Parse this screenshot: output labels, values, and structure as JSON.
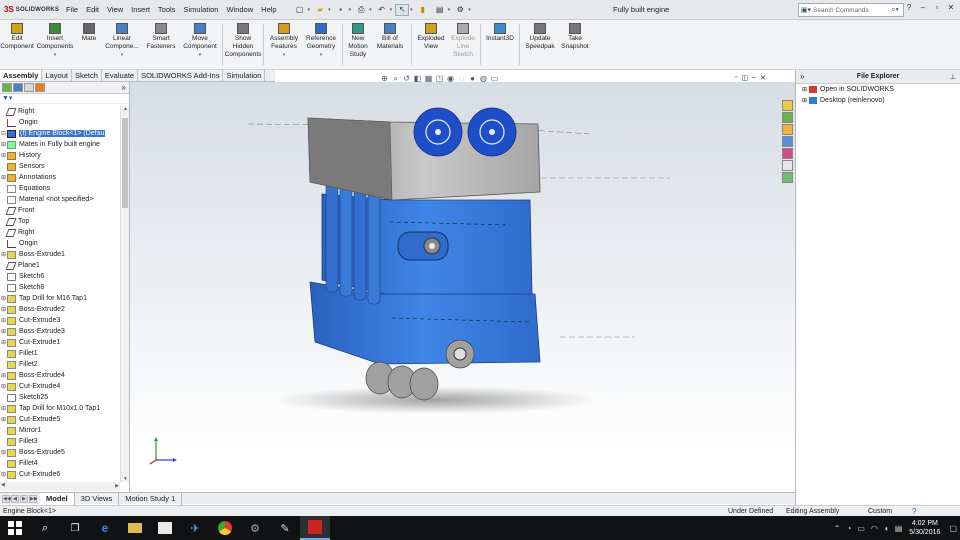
{
  "app": {
    "brand": "SOLIDWORKS",
    "document_title": "Fully built engine"
  },
  "menus": [
    "File",
    "Edit",
    "View",
    "Insert",
    "Tools",
    "Simulation",
    "Window",
    "Help"
  ],
  "search": {
    "placeholder": "Search Commands"
  },
  "command_manager": [
    {
      "label": "Edit\nComponent",
      "icon": "edit-component-icon"
    },
    {
      "label": "Insert\nComponents",
      "icon": "insert-components-icon",
      "dropdown": true
    },
    {
      "label": "Mate",
      "icon": "mate-icon"
    },
    {
      "label": "Linear\nCompone...",
      "icon": "linear-pattern-icon",
      "dropdown": true
    },
    {
      "label": "Smart\nFasteners",
      "icon": "smart-fasteners-icon"
    },
    {
      "label": "Move\nComponent",
      "icon": "move-component-icon",
      "dropdown": true
    },
    {
      "label": "Show\nHidden\nComponents",
      "icon": "show-hidden-icon"
    },
    {
      "label": "Assembly\nFeatures",
      "icon": "assembly-features-icon",
      "dropdown": true
    },
    {
      "label": "Reference\nGeometry",
      "icon": "reference-geometry-icon",
      "dropdown": true
    },
    {
      "label": "New\nMotion\nStudy",
      "icon": "motion-study-icon"
    },
    {
      "label": "Bill of\nMaterials",
      "icon": "bom-icon"
    },
    {
      "label": "Exploded\nView",
      "icon": "exploded-view-icon"
    },
    {
      "label": "Explode\nLine\nSketch",
      "icon": "explode-line-icon",
      "disabled": true
    },
    {
      "label": "Instant3D",
      "icon": "instant3d-icon"
    },
    {
      "label": "Update\nSpeedpak",
      "icon": "speedpak-icon"
    },
    {
      "label": "Take\nSnapshot",
      "icon": "snapshot-icon"
    }
  ],
  "tabs": [
    "Assembly",
    "Layout",
    "Sketch",
    "Evaluate",
    "SOLIDWORKS Add-Ins",
    "Simulation"
  ],
  "active_tab": "Assembly",
  "tree": [
    {
      "label": "Right",
      "icon": "plane",
      "exp": ""
    },
    {
      "label": "Origin",
      "icon": "origin",
      "exp": ""
    },
    {
      "label": "(f) Engine Block<1> (Defau",
      "icon": "part",
      "exp": "−",
      "selected": true
    },
    {
      "label": "Mates in Fully built engine",
      "icon": "mates",
      "exp": "+"
    },
    {
      "label": "History",
      "icon": "folder",
      "exp": "+"
    },
    {
      "label": "Sensors",
      "icon": "folder",
      "exp": ""
    },
    {
      "label": "Annotations",
      "icon": "folder",
      "exp": "+"
    },
    {
      "label": "Equations",
      "icon": "eq",
      "exp": ""
    },
    {
      "label": "Material <not specified>",
      "icon": "eq",
      "exp": ""
    },
    {
      "label": "Front",
      "icon": "plane",
      "exp": ""
    },
    {
      "label": "Top",
      "icon": "plane",
      "exp": ""
    },
    {
      "label": "Right",
      "icon": "plane",
      "exp": ""
    },
    {
      "label": "Origin",
      "icon": "origin",
      "exp": ""
    },
    {
      "label": "Boss-Extrude1",
      "icon": "feat",
      "exp": "+"
    },
    {
      "label": "Plane1",
      "icon": "plane",
      "exp": ""
    },
    {
      "label": "Sketch6",
      "icon": "sketch",
      "exp": ""
    },
    {
      "label": "Sketch8",
      "icon": "sketch",
      "exp": ""
    },
    {
      "label": "Tap Drill for M16 Tap1",
      "icon": "feat",
      "exp": "+"
    },
    {
      "label": "Boss-Extrude2",
      "icon": "feat",
      "exp": "+"
    },
    {
      "label": "Cut-Extrude3",
      "icon": "feat",
      "exp": "+"
    },
    {
      "label": "Boss-Extrude3",
      "icon": "feat",
      "exp": "+"
    },
    {
      "label": "Cut-Extrude1",
      "icon": "feat",
      "exp": "+"
    },
    {
      "label": "Fillet1",
      "icon": "feat",
      "exp": ""
    },
    {
      "label": "Fillet2",
      "icon": "feat",
      "exp": ""
    },
    {
      "label": "Boss-Extrude4",
      "icon": "feat",
      "exp": "+"
    },
    {
      "label": "Cut-Extrude4",
      "icon": "feat",
      "exp": "+"
    },
    {
      "label": "Sketch25",
      "icon": "sketch",
      "exp": ""
    },
    {
      "label": "Tap Drill for M10x1.0 Tap1",
      "icon": "feat",
      "exp": "+"
    },
    {
      "label": "Cut-Extrude5",
      "icon": "feat",
      "exp": "+"
    },
    {
      "label": "Mirror1",
      "icon": "feat",
      "exp": ""
    },
    {
      "label": "Fillet3",
      "icon": "feat",
      "exp": ""
    },
    {
      "label": "Boss-Extrude5",
      "icon": "feat",
      "exp": "+"
    },
    {
      "label": "Fillet4",
      "icon": "feat",
      "exp": ""
    },
    {
      "label": "Cut-Extrude6",
      "icon": "feat",
      "exp": "+"
    }
  ],
  "file_explorer": {
    "title": "File Explorer",
    "items": [
      {
        "label": "Open in SOLIDWORKS",
        "color": "#d23b2b"
      },
      {
        "label": "Desktop (reinlenovo)",
        "color": "#2d7fd3"
      }
    ]
  },
  "bottom_tabs": [
    "Model",
    "3D Views",
    "Motion Study 1"
  ],
  "active_bottom_tab": "Model",
  "status": {
    "left": "Engine Block<1>",
    "defined": "Under Defined",
    "mode": "Editing Assembly",
    "units": "Custom",
    "help": "?"
  },
  "taskbar": {
    "time": "4:02 PM",
    "date": "5/30/2016"
  },
  "colors": {
    "part_blue": "#3a7ad6",
    "gear_blue": "#1f4fc8",
    "selection": "#3b73d1"
  }
}
